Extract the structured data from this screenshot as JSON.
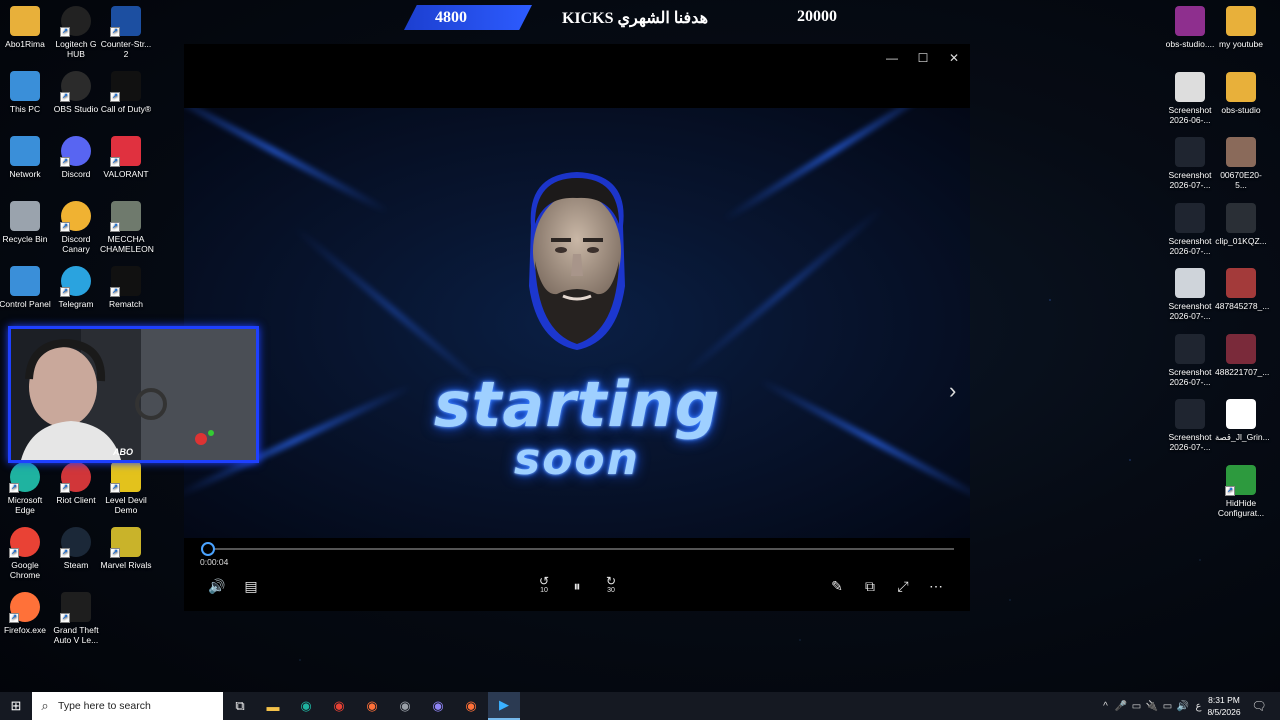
{
  "overlay": {
    "goal_current": "4800",
    "goal_label": "هدفنا الشهري KICKS",
    "goal_target": "20000"
  },
  "desktop_left": [
    {
      "label": "Abo1Rima",
      "icon": "folder-icon",
      "color": "#e8b03a"
    },
    {
      "label": "Logitech G HUB",
      "icon": "logitech-g-icon",
      "color": "#222222"
    },
    {
      "label": "Counter-Str... 2",
      "icon": "counter-strike-icon",
      "color": "#1c4fa1"
    },
    {
      "label": "This PC",
      "icon": "computer-icon",
      "color": "#3a8fd9"
    },
    {
      "label": "OBS Studio",
      "icon": "obs-icon",
      "color": "#2b2b2b"
    },
    {
      "label": "Call of Duty®",
      "icon": "call-of-duty-icon",
      "color": "#111111"
    },
    {
      "label": "Network",
      "icon": "network-icon",
      "color": "#3a8fd9"
    },
    {
      "label": "Discord",
      "icon": "discord-icon",
      "color": "#5865f2"
    },
    {
      "label": "VALORANT",
      "icon": "valorant-icon",
      "color": "#e0313f"
    },
    {
      "label": "Recycle Bin",
      "icon": "recycle-bin-icon",
      "color": "#9aa3ad"
    },
    {
      "label": "Discord Canary",
      "icon": "discord-canary-icon",
      "color": "#f0b232"
    },
    {
      "label": "MECCHA CHAMELEON",
      "icon": "game-icon",
      "color": "#6f7a6d"
    },
    {
      "label": "Control Panel",
      "icon": "control-panel-icon",
      "color": "#3a8fd9"
    },
    {
      "label": "Telegram",
      "icon": "telegram-icon",
      "color": "#2aa3df"
    },
    {
      "label": "Rematch",
      "icon": "rematch-icon",
      "color": "#111111"
    },
    {
      "label": "Microsoft Edge",
      "icon": "edge-icon",
      "color": "#1fb3a0"
    },
    {
      "label": "Riot Client",
      "icon": "riot-icon",
      "color": "#d13639"
    },
    {
      "label": "Level Devil Demo",
      "icon": "level-devil-icon",
      "color": "#e3c21c"
    },
    {
      "label": "Google Chrome",
      "icon": "chrome-icon",
      "color": "#e94235"
    },
    {
      "label": "Steam",
      "icon": "steam-icon",
      "color": "#1b2838"
    },
    {
      "label": "Marvel Rivals",
      "icon": "marvel-rivals-icon",
      "color": "#c9b32a"
    },
    {
      "label": "Firefox.exe",
      "icon": "firefox-icon",
      "color": "#ff7139"
    },
    {
      "label": "Grand Theft Auto V Le...",
      "icon": "gta-icon",
      "color": "#1e1e1e"
    }
  ],
  "desktop_right": [
    {
      "label": "obs-studio....",
      "icon": "winrar-icon",
      "color": "#8e2f8e"
    },
    {
      "label": "my youtube",
      "icon": "folder-icon",
      "color": "#e8b03a"
    },
    {
      "label": "Screenshot 2026-06-...",
      "icon": "screenshot-icon",
      "color": "#dddddd"
    },
    {
      "label": "obs-studio",
      "icon": "folder-icon",
      "color": "#e8b03a"
    },
    {
      "label": "Screenshot 2026-07-...",
      "icon": "screenshot-icon",
      "color": "#1f2530"
    },
    {
      "label": "00670E20-5...",
      "icon": "image-icon",
      "color": "#8a6a5a"
    },
    {
      "label": "Screenshot 2026-07-...",
      "icon": "screenshot-icon",
      "color": "#1f2530"
    },
    {
      "label": "clip_01KQZ...",
      "icon": "video-clip-icon",
      "color": "#2a2f36"
    },
    {
      "label": "Screenshot 2026-07-...",
      "icon": "screenshot-icon",
      "color": "#cfd4da"
    },
    {
      "label": "487845278_...",
      "icon": "image-icon",
      "color": "#a33a3a"
    },
    {
      "label": "Screenshot 2026-07-...",
      "icon": "screenshot-icon",
      "color": "#1f2530"
    },
    {
      "label": "488221707_...",
      "icon": "image-icon",
      "color": "#7a2a3a"
    },
    {
      "label": "Screenshot 2026-07-...",
      "icon": "screenshot-icon",
      "color": "#1f2530"
    },
    {
      "label": "قصة_Jl_Grin...",
      "icon": "video-file-icon",
      "color": "#ffffff"
    },
    {
      "label": "HidHide Configurat...",
      "icon": "hidhide-icon",
      "color": "#2d9a3e"
    }
  ],
  "player": {
    "elapsed_time": "0:00:04",
    "progress": 0.0,
    "controls": {
      "minimize": "—",
      "maximize": "☐",
      "close": "✕",
      "volume": "🔊",
      "subtitles": "▤",
      "rewind": "↺",
      "pause": "⏸",
      "forward": "↻",
      "edit": "✎",
      "miniplayer": "⧉",
      "fullscreen": "⤢",
      "more": "⋯",
      "next": "›",
      "rewind_num": "10",
      "forward_num": "30"
    },
    "title_line1": "starting",
    "title_line2": "soon"
  },
  "webcam": {
    "name": "ABO"
  },
  "taskbar": {
    "start": "⊞",
    "search_placeholder": "Type here to search",
    "search_icon": "⌕",
    "task_view": "⧉",
    "pinned": [
      {
        "name": "file-explorer-icon",
        "glyph": "▬",
        "color": "#f3c14a"
      },
      {
        "name": "edge-icon",
        "glyph": "◉",
        "color": "#1fb3a0"
      },
      {
        "name": "chrome-icon",
        "glyph": "◉",
        "color": "#e94235"
      },
      {
        "name": "firefox-icon",
        "glyph": "◉",
        "color": "#ff7139"
      },
      {
        "name": "obs-icon",
        "glyph": "◉",
        "color": "#9aa0a8"
      },
      {
        "name": "discord-canary-icon",
        "glyph": "◉",
        "color": "#8f84f5"
      },
      {
        "name": "firefox-icon",
        "glyph": "◉",
        "color": "#ff7139"
      },
      {
        "name": "media-player-icon",
        "glyph": "▶",
        "color": "#3ab0ff"
      }
    ],
    "tray": [
      "^",
      "🎤",
      "▭",
      "🔌",
      "▭",
      "🔊",
      "ع"
    ],
    "time": "8:31 PM",
    "date": "8/5/2026",
    "notification": "🗨"
  }
}
